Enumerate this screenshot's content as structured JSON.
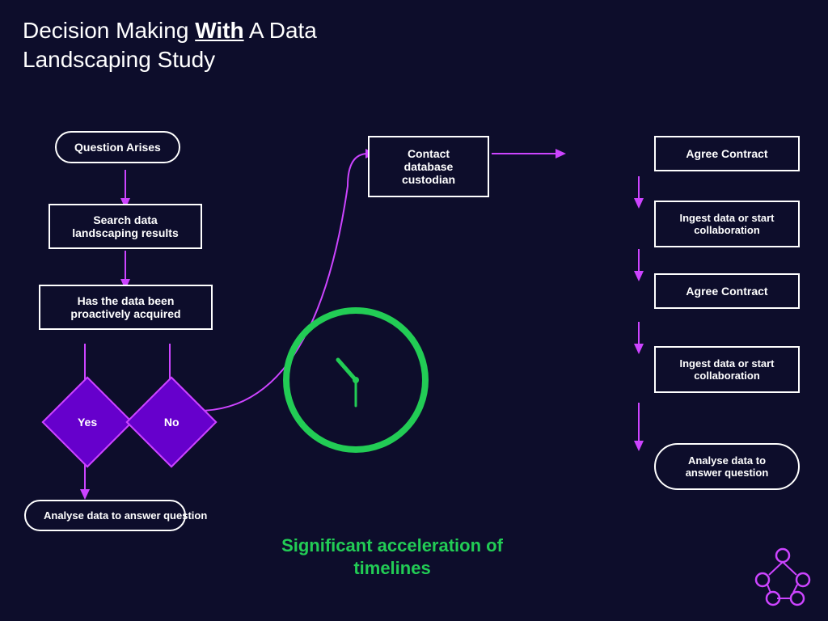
{
  "title": {
    "line1": "Decision Making ",
    "with": "With",
    "line2": " A Data",
    "line3": "Landscaping Study"
  },
  "flowchart": {
    "left": {
      "question_arises": "Question Arises",
      "search_data": "Search data landscaping results",
      "has_data": "Has the data been proactively acquired",
      "yes": "Yes",
      "no": "No",
      "analyse_left": "Analyse data to answer question"
    },
    "center": {
      "contact": "Contact database custodian"
    },
    "right": {
      "agree1": "Agree Contract",
      "ingest1": "Ingest data or start collaboration",
      "agree2": "Agree Contract",
      "ingest2": "Ingest data or start collaboration",
      "analyse": "Analyse data to answer question"
    }
  },
  "bottom": {
    "acceleration": "Significant acceleration of timelines"
  },
  "colors": {
    "bg": "#0d0d2b",
    "arrow": "#cc44ff",
    "clock": "#22cc55",
    "accent_text": "#22cc55",
    "diamond_fill": "#6600cc",
    "diamond_border": "#cc44ff"
  }
}
